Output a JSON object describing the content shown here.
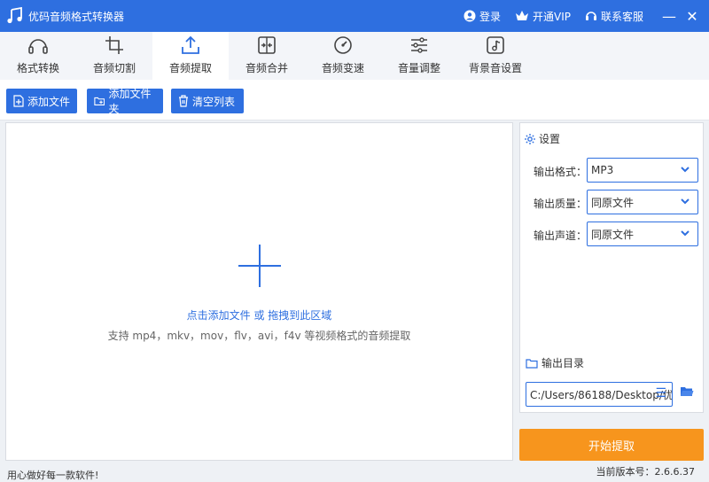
{
  "titlebar": {
    "title": "优码音频格式转换器",
    "login": "登录",
    "vip": "开通VIP",
    "support": "联系客服",
    "minimize": "—",
    "close": "✕"
  },
  "tabs": [
    {
      "label": "格式转换",
      "icon": "headphones-icon"
    },
    {
      "label": "音频切割",
      "icon": "crop-icon"
    },
    {
      "label": "音频提取",
      "icon": "upload-icon"
    },
    {
      "label": "音频合并",
      "icon": "merge-icon"
    },
    {
      "label": "音频变速",
      "icon": "speed-dial-icon"
    },
    {
      "label": "音量调整",
      "icon": "sliders-icon"
    },
    {
      "label": "背景音设置",
      "icon": "music-note-icon"
    }
  ],
  "active_tab": "音频提取",
  "toolbar": {
    "add_file": "添加文件",
    "add_folder": "添加文件夹",
    "clear_list": "清空列表"
  },
  "dropzone": {
    "hint": "点击添加文件 或 拖拽到此区域",
    "sub": "支持 mp4，mkv，mov，flv，avi，f4v 等视频格式的音频提取"
  },
  "settings": {
    "title": "设置",
    "format_label": "输出格式：",
    "format_value": "MP3",
    "quality_label": "输出质量：",
    "quality_value": "同原文件",
    "channel_label": "输出声道：",
    "channel_value": "同原文件",
    "output_dir_label": "输出目录",
    "output_dir_value": "C:/Users/86188/Desktop/优",
    "path_menu": "☰"
  },
  "start_button": "开始提取",
  "footer": {
    "slogan": "用心做好每一款软件!",
    "version": "当前版本号：2.6.6.37"
  },
  "colors": {
    "primary": "#2e6fe0",
    "accent": "#f7951d"
  }
}
